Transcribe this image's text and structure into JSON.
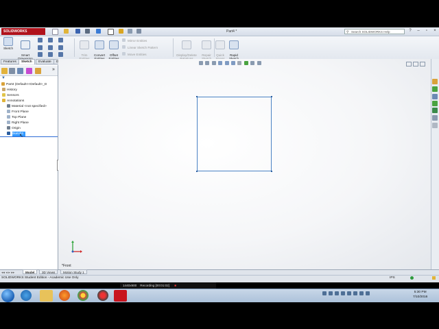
{
  "app": {
    "logo": "SOLIDWORKS",
    "doc_title": "Part4 *",
    "search_placeholder": "Search SOLIDWORKS Help"
  },
  "command_manager": {
    "sketch": "Sketch",
    "smart_dimension": "Smart\nDimension",
    "trim": "Trim\nEntities",
    "convert": "Convert\nEntities",
    "offset": "Offset\nEntities",
    "mirror": "Mirror Entities",
    "linear_pattern": "Linear Sketch Pattern",
    "move": "Move Entities",
    "display_delete": "Display/Delete\nRelations",
    "repair": "Repair\nSketch",
    "quick_snaps": "Quick\nSnaps",
    "rapid_sketch": "Rapid\nSketch"
  },
  "tabs": [
    "Features",
    "Sketch",
    "Evaluate",
    "DimXpert",
    "SOLIDWORKS Add-Ins",
    "Simulation",
    "SOLIDWORKS MBD"
  ],
  "active_tab": "Sketch",
  "tree": {
    "root": "Part4  (Default<<Default>_D",
    "items": [
      "History",
      "Sensors",
      "Annotations",
      "Material <not specified>",
      "Front Plane",
      "Top Plane",
      "Right Plane",
      "Origin",
      "Sketch1"
    ]
  },
  "viewport": {
    "view_label": "*Front"
  },
  "bottom_tabs": [
    "Model",
    "3D Views",
    "Motion Study 1"
  ],
  "status": {
    "text": "SOLIDWORKS Student Edition - Academic Use Only",
    "units": "IPS"
  },
  "recorder": {
    "resolution": "1440x900",
    "recording": "Recording [00:01:02]"
  },
  "clock": {
    "time": "5:30 PM",
    "date": "7/10/2016"
  },
  "colors": {
    "brand": "#b0121b",
    "sketch_line": "#4a82c4",
    "selection": "#3399ff"
  }
}
